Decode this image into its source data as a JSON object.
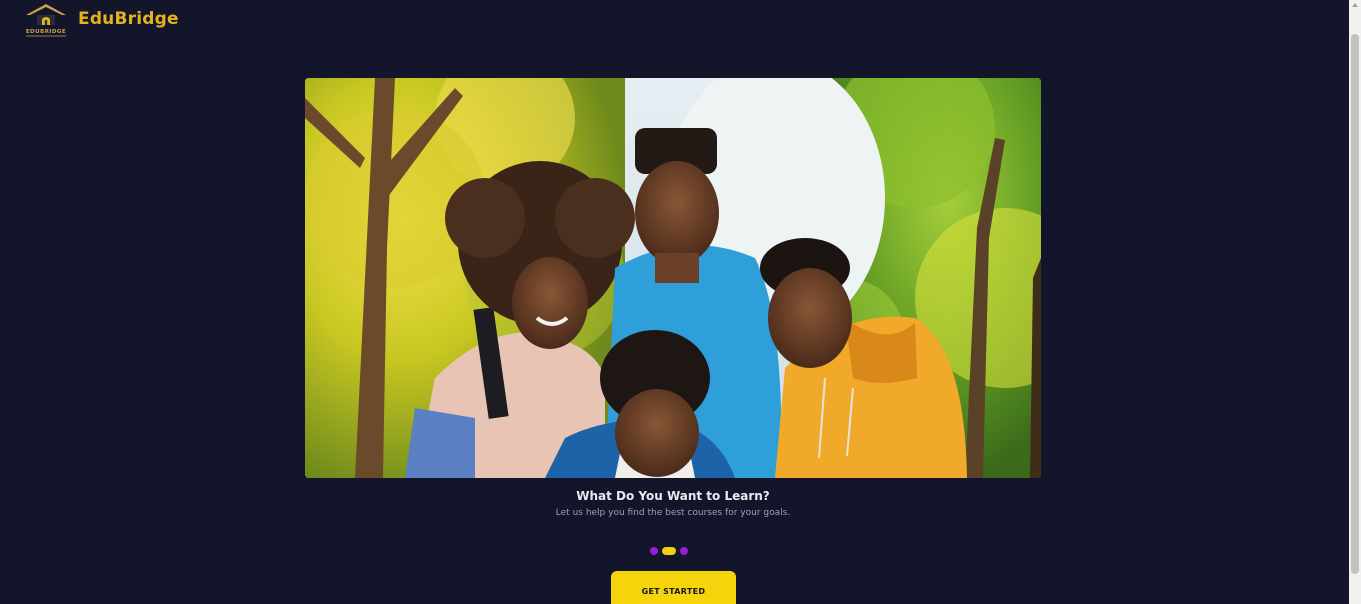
{
  "brand": {
    "name": "EduBridge",
    "logo_text": "EDUBRIDGE",
    "accent_color": "#e3b21f"
  },
  "slide": {
    "image_alt": "Four students looking down together in a park",
    "title": "What Do You Want to Learn?",
    "subtitle": "Let us help you find the best courses for your goals."
  },
  "carousel": {
    "dot_count": 3,
    "active_index": 1,
    "dot_color": "#9b1bd6",
    "active_color": "#f2cf14"
  },
  "cta": {
    "label": "GET STARTED",
    "color": "#f5d40c"
  },
  "theme": {
    "background": "#13152a"
  }
}
